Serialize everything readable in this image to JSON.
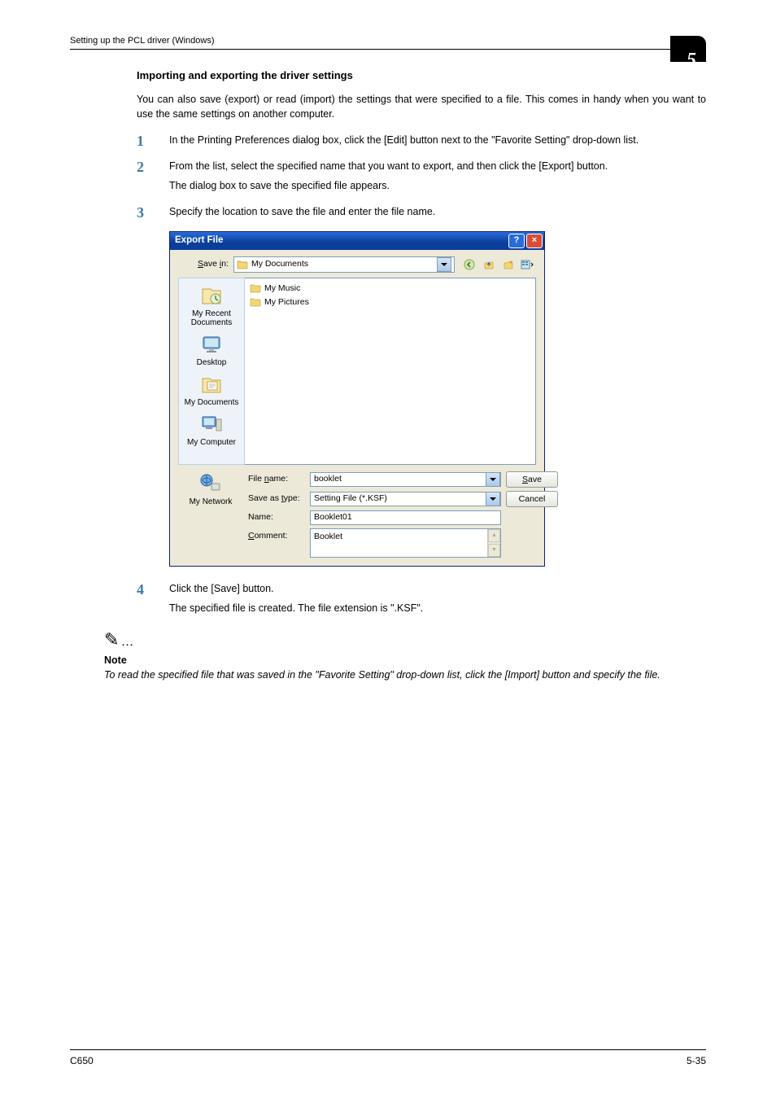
{
  "header": {
    "running_head": "Setting up the PCL driver (Windows)",
    "chapter_num": "5"
  },
  "footer": {
    "left": "C650",
    "right": "5-35"
  },
  "body": {
    "heading": "Importing and exporting the driver settings",
    "intro": "You can also save (export) or read (import) the settings that were specified to a file. This comes in handy when you want to use the same settings on another computer.",
    "steps": [
      {
        "num": "1",
        "text": "In the Printing Preferences dialog box, click the [Edit] button next to the \"Favorite Setting\" drop-down list."
      },
      {
        "num": "2",
        "text": "From the list, select the specified name that you want to export, and then click the [Export] button.",
        "sub": "The dialog box to save the specified file appears."
      },
      {
        "num": "3",
        "text": "Specify the location to save the file and enter the file name."
      },
      {
        "num": "4",
        "text": "Click the [Save] button.",
        "sub": "The specified file is created. The file extension is \".KSF\"."
      }
    ],
    "note": {
      "label": "Note",
      "text": "To read the specified file that was saved in the \"Favorite Setting\" drop-down list, click the [Import] button and specify the file."
    }
  },
  "dialog": {
    "title": "Export File",
    "savein_label": "Save in:",
    "savein_value": "My Documents",
    "toolbar": {
      "back": "back-icon",
      "up": "up-one-level-icon",
      "newfolder": "create-new-folder-icon",
      "views": "views-icon"
    },
    "places": [
      "My Recent Documents",
      "Desktop",
      "My Documents",
      "My Computer",
      "My Network"
    ],
    "files": [
      "My Music",
      "My Pictures"
    ],
    "filename_label": "File name:",
    "filename_value": "booklet",
    "saveas_label": "Save as type:",
    "saveas_value": "Setting File (*.KSF)",
    "name_label": "Name:",
    "name_value": "Booklet01",
    "comment_label": "Comment:",
    "comment_value": "Booklet",
    "save_btn": "Save",
    "cancel_btn": "Cancel"
  }
}
